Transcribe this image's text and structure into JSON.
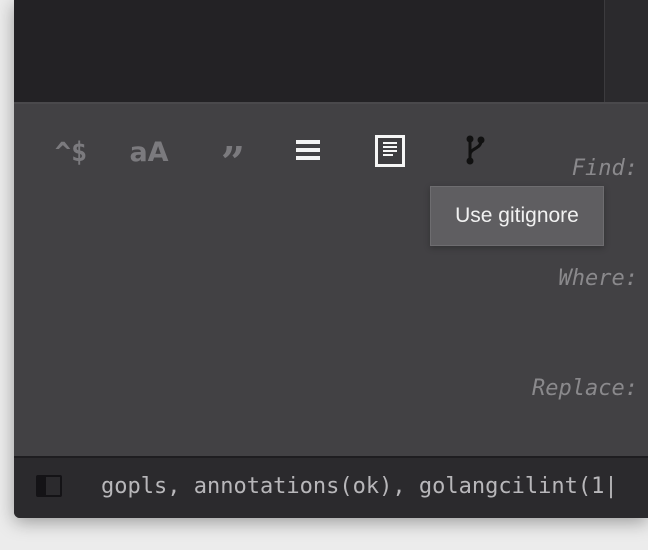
{
  "find_options": {
    "regex_glyph": "^$",
    "case_glyph": "aA",
    "whole_word_glyph": "”",
    "in_selection_icon": "lines-icon",
    "wrap_icon": "document-icon",
    "gitignore_icon": "git-branch-icon"
  },
  "labels": {
    "find": "Find:",
    "where": "Where:",
    "replace": "Replace:"
  },
  "tooltip": {
    "text": "Use gitignore"
  },
  "statusbar": {
    "text": "gopls, annotations(ok), golangcilint(1|"
  },
  "colors": {
    "panel": "#424144",
    "editor": "#232225",
    "statusbar": "#2b2a2d",
    "tooltip": "#5f5e61"
  }
}
